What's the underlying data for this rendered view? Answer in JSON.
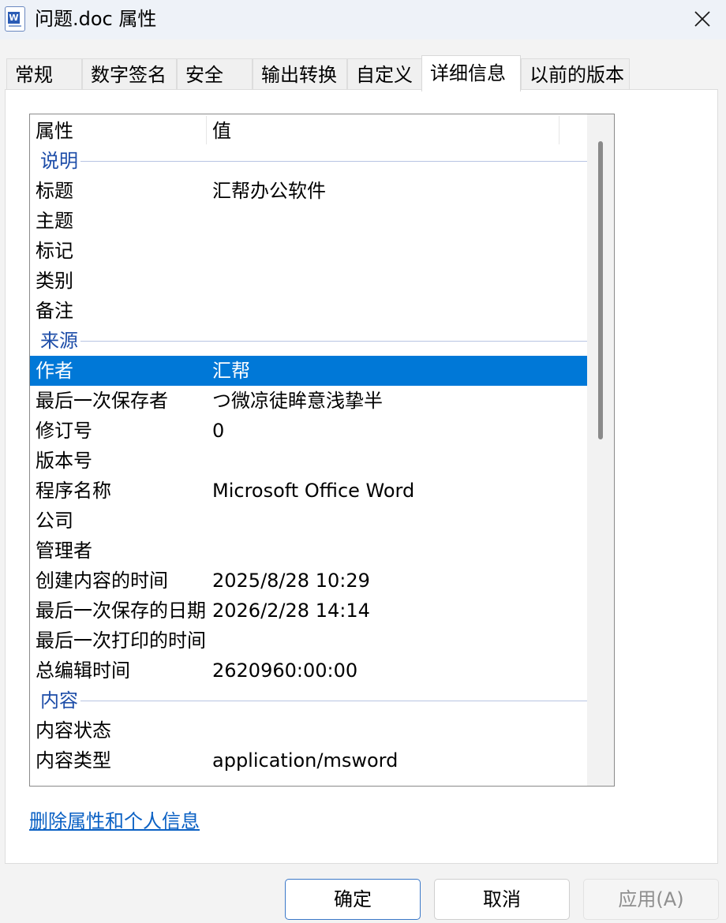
{
  "window": {
    "title": "问题.doc 属性",
    "icon": "word-document-icon",
    "close_icon": "close-icon"
  },
  "tabs": [
    {
      "label": "常规"
    },
    {
      "label": "数字签名"
    },
    {
      "label": "安全"
    },
    {
      "label": "输出转换"
    },
    {
      "label": "自定义"
    },
    {
      "label": "详细信息",
      "active": true
    },
    {
      "label": "以前的版本"
    }
  ],
  "list": {
    "header": {
      "property": "属性",
      "value": "值"
    },
    "rows": [
      {
        "type": "group",
        "label": "说明"
      },
      {
        "type": "item",
        "name": "标题",
        "value": "汇帮办公软件"
      },
      {
        "type": "item",
        "name": "主题",
        "value": ""
      },
      {
        "type": "item",
        "name": "标记",
        "value": ""
      },
      {
        "type": "item",
        "name": "类别",
        "value": ""
      },
      {
        "type": "item",
        "name": "备注",
        "value": ""
      },
      {
        "type": "group",
        "label": "来源"
      },
      {
        "type": "item",
        "name": "作者",
        "value": "汇帮",
        "selected": true
      },
      {
        "type": "item",
        "name": "最后一次保存者",
        "value": "つ微凉徒眸意浅挚半"
      },
      {
        "type": "item",
        "name": "修订号",
        "value": "0"
      },
      {
        "type": "item",
        "name": "版本号",
        "value": ""
      },
      {
        "type": "item",
        "name": "程序名称",
        "value": "Microsoft Office Word"
      },
      {
        "type": "item",
        "name": "公司",
        "value": ""
      },
      {
        "type": "item",
        "name": "管理者",
        "value": ""
      },
      {
        "type": "item",
        "name": "创建内容的时间",
        "value": "2025/8/28 10:29"
      },
      {
        "type": "item",
        "name": "最后一次保存的日期",
        "value": "2026/2/28 14:14"
      },
      {
        "type": "item",
        "name": "最后一次打印的时间",
        "value": ""
      },
      {
        "type": "item",
        "name": "总编辑时间",
        "value": "2620960:00:00"
      },
      {
        "type": "group",
        "label": "内容"
      },
      {
        "type": "item",
        "name": "内容状态",
        "value": ""
      },
      {
        "type": "item",
        "name": "内容类型",
        "value": "application/msword"
      }
    ]
  },
  "remove_link": "删除属性和个人信息",
  "buttons": {
    "ok": "确定",
    "cancel": "取消",
    "apply": "应用(A)"
  },
  "colors": {
    "selection": "#0078d7",
    "group_text": "#1d4da8",
    "link": "#0b61c4"
  }
}
